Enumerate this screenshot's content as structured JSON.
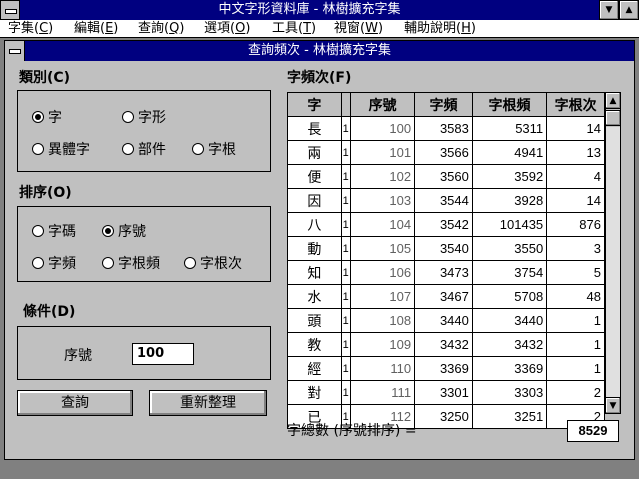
{
  "app": {
    "title": "中文字形資料庫 - 林樹擴充字集",
    "menu": [
      {
        "label": "字集(",
        "key": "C",
        "tail": ")"
      },
      {
        "label": "編輯(",
        "key": "E",
        "tail": ")"
      },
      {
        "label": "查詢(",
        "key": "Q",
        "tail": ")"
      },
      {
        "label": "選項(",
        "key": "O",
        "tail": ")"
      },
      {
        "label": "工具(",
        "key": "T",
        "tail": ")"
      },
      {
        "label": "視窗(",
        "key": "W",
        "tail": ")"
      },
      {
        "label": "輔助說明(",
        "key": "H",
        "tail": ")"
      }
    ]
  },
  "window": {
    "title": "查詢頻次 - 林樹擴充字集"
  },
  "category": {
    "label": "類別(C)",
    "options": [
      "字",
      "字形",
      "異體字",
      "部件",
      "字根"
    ],
    "selected": "字"
  },
  "sort": {
    "label": "排序(O)",
    "options": [
      "字碼",
      "序號",
      "字頻",
      "字根頻",
      "字根次"
    ],
    "selected": "序號"
  },
  "condition": {
    "label": "條件(D)",
    "field_label": "序號",
    "field_value": "100"
  },
  "buttons": {
    "query": "查詢",
    "refresh": "重新整理"
  },
  "table": {
    "label": "字頻次(F)",
    "columns": [
      "字",
      "",
      "序號",
      "字頻",
      "字根頻",
      "字根次"
    ],
    "rows": [
      [
        "長",
        "1",
        "100",
        "3583",
        "5311",
        "14"
      ],
      [
        "兩",
        "1",
        "101",
        "3566",
        "4941",
        "13"
      ],
      [
        "便",
        "1",
        "102",
        "3560",
        "3592",
        "4"
      ],
      [
        "因",
        "1",
        "103",
        "3544",
        "3928",
        "14"
      ],
      [
        "八",
        "1",
        "104",
        "3542",
        "101435",
        "876"
      ],
      [
        "動",
        "1",
        "105",
        "3540",
        "3550",
        "3"
      ],
      [
        "知",
        "1",
        "106",
        "3473",
        "3754",
        "5"
      ],
      [
        "水",
        "1",
        "107",
        "3467",
        "5708",
        "48"
      ],
      [
        "頭",
        "1",
        "108",
        "3440",
        "3440",
        "1"
      ],
      [
        "教",
        "1",
        "109",
        "3432",
        "3432",
        "1"
      ],
      [
        "經",
        "1",
        "110",
        "3369",
        "3369",
        "1"
      ],
      [
        "對",
        "1",
        "111",
        "3301",
        "3303",
        "2"
      ],
      [
        "已",
        "1",
        "112",
        "3250",
        "3251",
        "2"
      ]
    ]
  },
  "total": {
    "label": "字總數 (序號排序) =",
    "value": "8529"
  },
  "icons": {
    "system_menu": "system-menu-icon",
    "minimize": "minimize-icon",
    "maximize": "maximize-icon",
    "scroll_up": "arrow-up-icon",
    "scroll_down": "arrow-down-icon"
  }
}
